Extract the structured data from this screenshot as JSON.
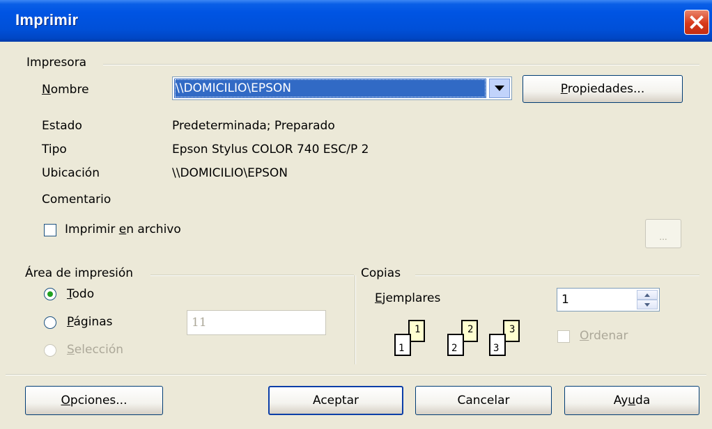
{
  "window": {
    "title": "Imprimir",
    "close_icon": "close-icon"
  },
  "printer": {
    "group_label": "Impresora",
    "name_label_accel": "N",
    "name_label_rest": "ombre",
    "name_value": "\\\\DOMICILIO\\EPSON",
    "properties_accel": "P",
    "properties_rest": "ropiedades...",
    "estado_label": "Estado",
    "estado_value": "Predeterminada; Preparado",
    "tipo_label": "Tipo",
    "tipo_value": "Epson Stylus COLOR 740 ESC/P 2",
    "ubicacion_label": "Ubicación",
    "ubicacion_value": "\\\\DOMICILIO\\EPSON",
    "comentario_label": "Comentario",
    "print_to_file_pre": "Imprimir ",
    "print_to_file_accel": "e",
    "print_to_file_post": "n archivo",
    "print_to_file_checked": false,
    "browse_label": "..."
  },
  "area": {
    "group_label": "Área de impresión",
    "todo_accel": "T",
    "todo_rest": "odo",
    "paginas_accel": "P",
    "paginas_rest": "áginas",
    "paginas_value": "11",
    "seleccion_accel": "S",
    "seleccion_rest": "elección",
    "selected": "todo"
  },
  "copias": {
    "group_label": "Copias",
    "ejemplares_accel": "E",
    "ejemplares_rest": "jemplares",
    "ejemplares_value": "1",
    "ordenar_accel": "O",
    "ordenar_rest": "rdenar",
    "ordenar_checked": false,
    "collate_pages": [
      "1",
      "2",
      "3"
    ]
  },
  "buttons": {
    "opciones_accel": "O",
    "opciones_rest": "pciones...",
    "aceptar": "Aceptar",
    "cancelar": "Cancelar",
    "ayuda_pre": "Ay",
    "ayuda_accel": "u",
    "ayuda_post": "da"
  },
  "colors": {
    "titlebar": "#0054e3",
    "dialog_bg": "#ece9d8",
    "selection": "#316ac5",
    "disabled_text": "#aca899",
    "close_button": "#d8391a"
  }
}
